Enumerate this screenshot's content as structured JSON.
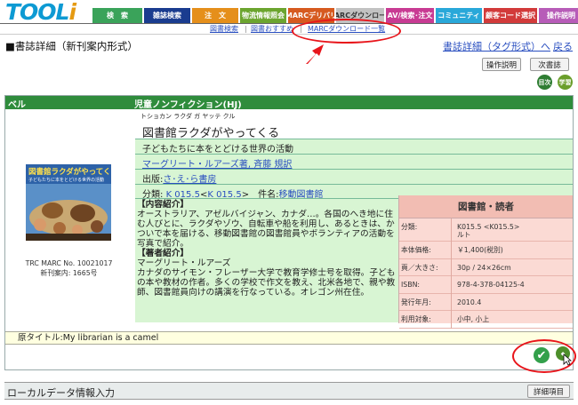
{
  "logo": {
    "text_main": "TOOL",
    "text_i": "i"
  },
  "menu": [
    {
      "label": "検　索",
      "color": "#3aa35a",
      "width": 56
    },
    {
      "label": "雑誌検索",
      "color": "#1a3c8f",
      "width": 52
    },
    {
      "label": "注　文",
      "color": "#e58f1b",
      "width": 52
    },
    {
      "label": "物流情報照会",
      "color": "#6ca52f",
      "width": 52
    },
    {
      "label": "MARCデリバリ",
      "color": "#d65a1f",
      "width": 52
    },
    {
      "label": "MARCダウンロード",
      "color": "#c2c2c2",
      "width": 54
    },
    {
      "label": "AV/検索･注文",
      "color": "#c83b93",
      "width": 54
    },
    {
      "label": "コミュニティ",
      "color": "#29a8d9",
      "width": 52
    },
    {
      "label": "顧客コード選択",
      "color": "#d23a3a",
      "width": 60
    },
    {
      "label": "操作説明",
      "color": "#b75cb8",
      "width": 50
    }
  ],
  "subnav": {
    "item1": "図書検索",
    "item2": "図書おすすめ",
    "item3": "MARCダウンロード一覧",
    "sep": "|"
  },
  "page": {
    "title": "■書誌詳細（新刊案内形式）",
    "link_tag_format": "書誌詳細（タグ形式）へ",
    "link_back": "戻る"
  },
  "buttons": {
    "manual": "操作説明",
    "next": "次書誌",
    "local_detail": "詳細項目"
  },
  "icons": {
    "toc_label": "目次",
    "study_label": "学習"
  },
  "book": {
    "header_left": "ベル",
    "header_right": "児童ノンフィクション(HJ)",
    "kana": "トショカン ラクダ ガ ヤッテ クル",
    "title": "図書館ラクダがやってくる",
    "subtitle": "子どもたちに本をとどける世界の活動",
    "authors": "マーグリート・ルアーズ著, 斉藤 規訳",
    "publisher_label": "出版:",
    "publisher": "さ･え･ら書房",
    "class_label": "分類:",
    "class_k1": "K 015.5",
    "class_mid": "<",
    "class_k2": "K 015.5",
    "class_end": ">",
    "subject_label": "件名:",
    "subject": "移動図書館",
    "cover_title": "図書館ラクダがやってくる",
    "cover_subtitle": "子どもたちに本をとどける世界の活動",
    "caption_line1": "TRC MARC No. 10021017",
    "caption_line2": "新刊案内: 1665号",
    "desc_intro_heading": "【内容紹介】",
    "desc_intro": "オーストラリア、アゼルバイジャン、カナダ…。各国のへき地に住む人びとに、ラクダやゾウ、自転車や船を利用し、あるときは、かついで本を届ける、移動図書館の図書館員やボランティアの活動を写真で紹介。",
    "desc_author_heading": "【著者紹介】",
    "desc_author_name": "マーグリート・ルアーズ",
    "desc_author": "カナダのサイモン・フレーザー大学で教育学修士号を取得。子どもの本や教材の作者。多くの学校で作文を教え、北米各地で、親や教師、図書館員向けの講演を行なっている。オレゴン州在住。",
    "original_title": "原タイトル:My librarian is a camel"
  },
  "props": {
    "heading": "図書館・読者",
    "rows": [
      {
        "k": "分類:",
        "v": "K015.5 <K015.5>",
        "v2": "ルト"
      },
      {
        "k": "本体価格:",
        "v": "￥1,400(税別)",
        "v2": ""
      },
      {
        "k": "頁／大きさ:",
        "v": "30p / 24×26cm",
        "v2": ""
      },
      {
        "k": "ISBN:",
        "v": "978-4-378-04125-4",
        "v2": ""
      },
      {
        "k": "発行年月:",
        "v": "2010.4",
        "v2": ""
      },
      {
        "k": "利用対象:",
        "v": "小中, 小上",
        "v2": ""
      }
    ]
  },
  "local": {
    "title": "ローカルデータ情報入力"
  }
}
